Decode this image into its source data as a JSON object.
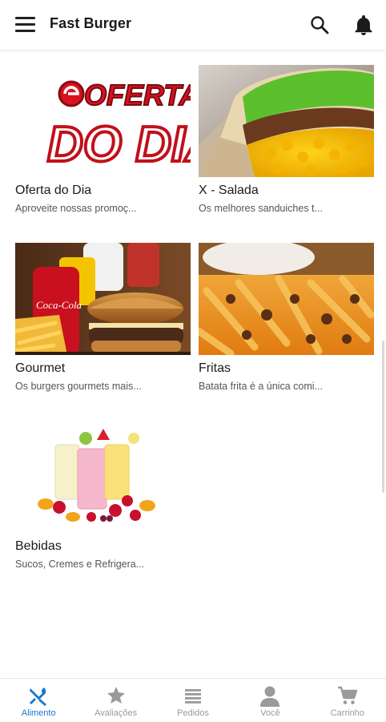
{
  "app": {
    "title": "Fast Burger"
  },
  "header": {
    "menu_icon": "hamburger-menu-icon",
    "search_icon": "search-icon",
    "notification_icon": "bell-icon"
  },
  "categories": [
    {
      "title": "Oferta do Dia",
      "description": "Aproveite nossas promoç...",
      "banner_line1": "OFERTA",
      "banner_line2": "DO DIA"
    },
    {
      "title": "X - Salada",
      "description": "Os melhores sanduiches t..."
    },
    {
      "title": "Gourmet",
      "description": "Os burgers gourmets mais...",
      "can_label": "Coca-Cola"
    },
    {
      "title": "Fritas",
      "description": "Batata frita é a única comi..."
    },
    {
      "title": "Bebidas",
      "description": "Sucos, Cremes e Refrigera..."
    }
  ],
  "bottom_nav": [
    {
      "label": "Alimento",
      "icon": "utensils-icon",
      "active": true
    },
    {
      "label": "Avaliações",
      "icon": "star-icon",
      "active": false
    },
    {
      "label": "Pedidos",
      "icon": "list-icon",
      "active": false
    },
    {
      "label": "Você",
      "icon": "person-icon",
      "active": false
    },
    {
      "label": "Carrinho",
      "icon": "cart-icon",
      "active": false
    }
  ],
  "colors": {
    "accent": "#1976d2",
    "inactive": "#9a9a9a",
    "banner_red": "#d7131f"
  }
}
